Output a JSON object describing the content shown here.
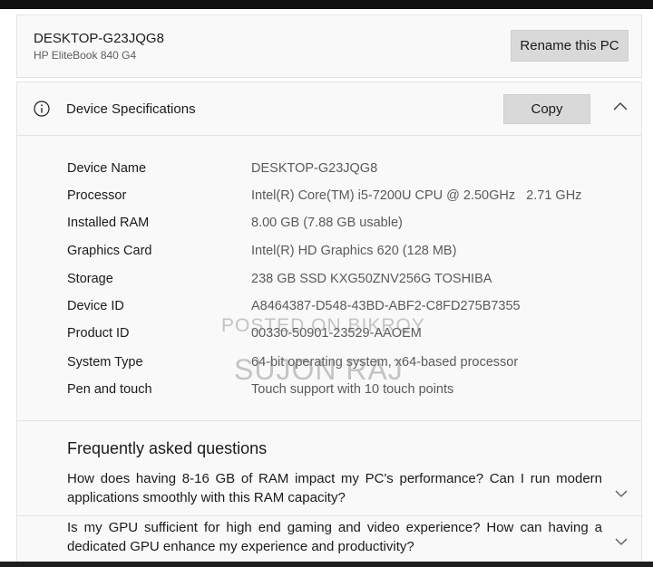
{
  "device": {
    "name": "DESKTOP-G23JQG8",
    "model": "HP EliteBook 840 G4",
    "rename_label": "Rename this PC"
  },
  "specs_section": {
    "title": "Device Specifications",
    "copy_label": "Copy",
    "icons": {
      "info": "info-icon",
      "collapse": "chevron-up-icon"
    },
    "rows": [
      {
        "label": "Device Name",
        "value": "DESKTOP-G23JQG8"
      },
      {
        "label": "Processor",
        "value": "Intel(R) Core(TM) i5-7200U CPU @ 2.50GHz   2.71 GHz"
      },
      {
        "label": "Installed RAM",
        "value": "8.00 GB (7.88 GB usable)"
      },
      {
        "label": "Graphics Card",
        "value": "Intel(R) HD Graphics 620 (128 MB)"
      },
      {
        "label": "Storage",
        "value": "238 GB SSD KXG50ZNV256G TOSHIBA"
      },
      {
        "label": "Device ID",
        "value": "A8464387-D548-43BD-ABF2-C8FD275B7355"
      },
      {
        "label": "Product ID",
        "value": "00330-50901-23529-AAOEM"
      },
      {
        "label": "System Type",
        "value": "64-bit operating system, x64-based processor"
      },
      {
        "label": "Pen and touch",
        "value": "Touch support with 10 touch points"
      }
    ]
  },
  "watermark": {
    "line1": "POSTED ON BIKROY",
    "line2": "SUJON RAJ"
  },
  "faq": {
    "title": "Frequently asked questions",
    "items": [
      {
        "question": "How does having 8-16 GB of RAM impact my PC's performance? Can I run modern applications smoothly with this RAM capacity?"
      },
      {
        "question": "Is my GPU sufficient for high end gaming and video experience? How can having a dedicated GPU enhance my experience and productivity?"
      }
    ],
    "expand_icon": "chevron-down-icon"
  },
  "colors": {
    "card_bg": "#f9f9f9",
    "button_bg": "#d9d9d9",
    "label_text": "#1b1b1b",
    "value_text": "#5a5a5a"
  }
}
